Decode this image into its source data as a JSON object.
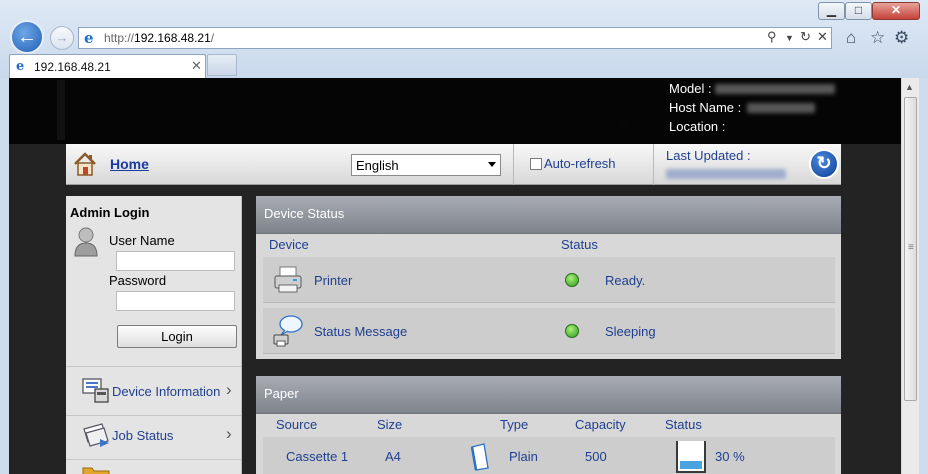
{
  "browser": {
    "url_scheme": "http://",
    "url_host": "192.168.48.21",
    "url_path": "/",
    "tab_title": "192.168.48.21"
  },
  "header": {
    "model_label": "Model :",
    "host_name_label": "Host Name :",
    "location_label": "Location :"
  },
  "navbar": {
    "home_label": "Home",
    "language_selected": "English",
    "autorefresh_label": "Auto-refresh",
    "last_updated_label": "Last Updated :"
  },
  "sidebar": {
    "admin_title": "Admin Login",
    "username_label": "User Name",
    "password_label": "Password",
    "login_label": "Login",
    "items": [
      {
        "label": "Device Information"
      },
      {
        "label": "Job Status"
      }
    ]
  },
  "device_status": {
    "title": "Device Status",
    "col_device": "Device",
    "col_status": "Status",
    "rows": [
      {
        "device": "Printer",
        "status": "Ready."
      },
      {
        "device": "Status Message",
        "status": "Sleeping"
      }
    ]
  },
  "paper": {
    "title": "Paper",
    "columns": [
      "Source",
      "Size",
      "Type",
      "Capacity",
      "Status"
    ],
    "rows": [
      {
        "source": "Cassette 1",
        "size": "A4",
        "type": "Plain",
        "capacity": "500",
        "status": "30 %",
        "level": 0.3
      }
    ]
  },
  "colors": {
    "link_blue": "#1f3f8f",
    "status_green": "#2d9a1a",
    "panel_header": "#8f929a"
  }
}
